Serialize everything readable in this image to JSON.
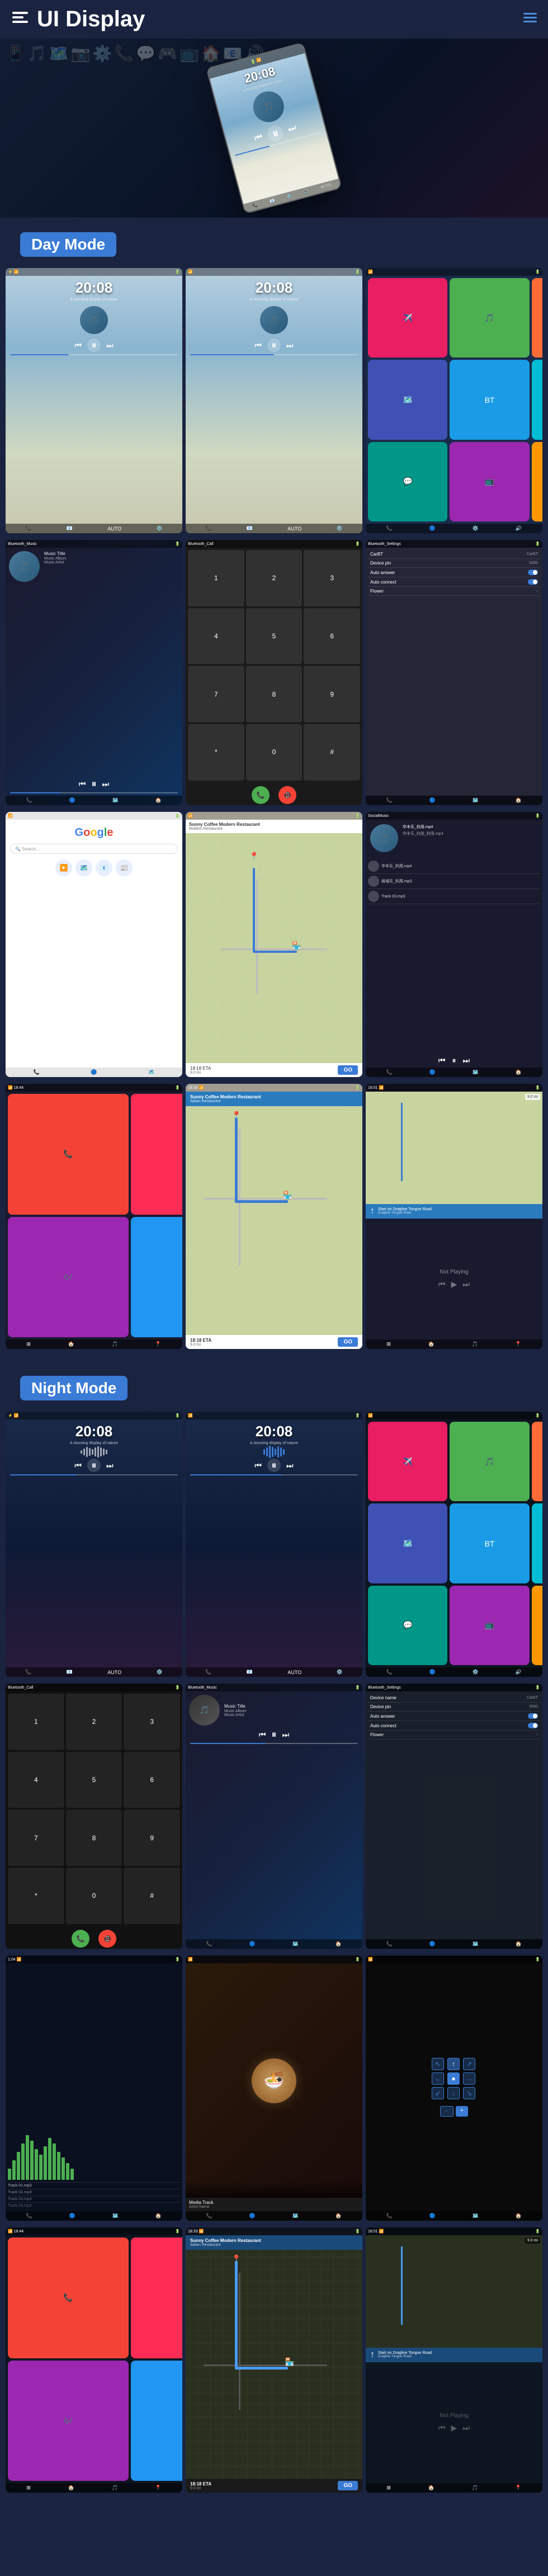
{
  "header": {
    "title": "UI Display",
    "menu_icon": "≡",
    "nav_icon": "≡"
  },
  "day_mode": {
    "label": "Day Mode"
  },
  "night_mode": {
    "label": "Night Mode"
  },
  "screens": {
    "time": "20:08",
    "subtitle": "A stunning display of nature",
    "music_title": "Music Title",
    "music_album": "Music Album",
    "music_artist": "Music Artist",
    "device_name": "CarBT",
    "device_pin": "0000",
    "auto_answer": "Auto answer",
    "auto_connect": "Auto connect",
    "flower": "Flower",
    "bluetooth_music": "Bluetooth_Music",
    "bluetooth_call": "Bluetooth_Call",
    "bluetooth_settings": "Bluetooth_Settings",
    "social_music": "SocialMusic",
    "local_music": "局域乐_利用.mp3",
    "google_search": "Google",
    "sunny_coffee": "Sunny Coffee Modern Restaurant",
    "eta": "18:18 ETA",
    "go": "GO",
    "distance": "9.0 mi",
    "not_playing": "Not Playing",
    "start_on": "Start on Dragline Tongue Road"
  },
  "wave_heights": [
    4,
    8,
    12,
    16,
    20,
    16,
    12,
    8,
    14,
    18,
    22,
    18,
    14,
    10,
    6,
    10,
    14,
    18,
    14,
    10
  ],
  "apps": {
    "colors": [
      "#E91E63",
      "#2196F3",
      "#4CAF50",
      "#FF9800",
      "#9C27B0",
      "#00BCD4",
      "#f44336",
      "#607D8B",
      "#3F51B5",
      "#FFC107",
      "#795548",
      "#8BC34A"
    ],
    "icons": [
      "📱",
      "🎵",
      "📷",
      "⚙️",
      "🗺️",
      "📞",
      "📺",
      "🎮",
      "📧",
      "🔊",
      "💬",
      "🏠"
    ]
  }
}
